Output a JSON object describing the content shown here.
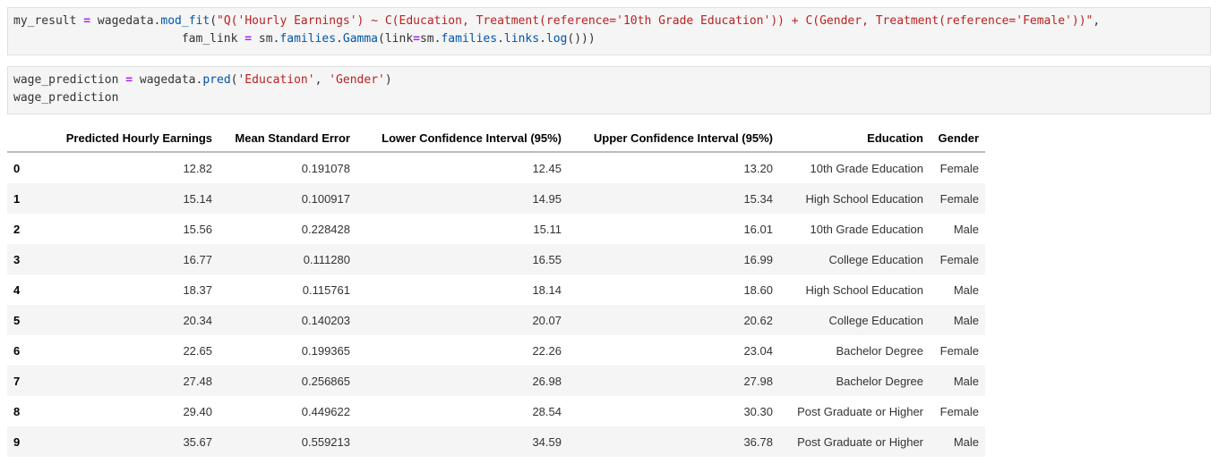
{
  "cells": [
    {
      "lines": [
        [
          {
            "t": "my_result ",
            "c": "tok"
          },
          {
            "t": "=",
            "c": "kw-op"
          },
          {
            "t": " wagedata.",
            "c": "tok"
          },
          {
            "t": "mod_fit",
            "c": "fn"
          },
          {
            "t": "(",
            "c": "tok"
          },
          {
            "t": "\"Q('Hourly Earnings') ~ C(Education, Treatment(reference='10th Grade Education')) + C(Gender, Treatment(reference='Female'))\"",
            "c": "str"
          },
          {
            "t": ",",
            "c": "tok"
          }
        ],
        [
          {
            "t": "                        fam_link ",
            "c": "tok"
          },
          {
            "t": "=",
            "c": "kw-op"
          },
          {
            "t": " sm.",
            "c": "tok"
          },
          {
            "t": "families",
            "c": "fn"
          },
          {
            "t": ".",
            "c": "tok"
          },
          {
            "t": "Gamma",
            "c": "fn"
          },
          {
            "t": "(link",
            "c": "tok"
          },
          {
            "t": "=",
            "c": "kw-op"
          },
          {
            "t": "sm.",
            "c": "tok"
          },
          {
            "t": "families",
            "c": "fn"
          },
          {
            "t": ".",
            "c": "tok"
          },
          {
            "t": "links",
            "c": "fn"
          },
          {
            "t": ".",
            "c": "tok"
          },
          {
            "t": "log",
            "c": "fn"
          },
          {
            "t": "()))",
            "c": "tok"
          }
        ]
      ]
    },
    {
      "lines": [
        [
          {
            "t": "wage_prediction ",
            "c": "tok"
          },
          {
            "t": "=",
            "c": "kw-op"
          },
          {
            "t": " wagedata.",
            "c": "tok"
          },
          {
            "t": "pred",
            "c": "fn"
          },
          {
            "t": "(",
            "c": "tok"
          },
          {
            "t": "'Education'",
            "c": "str"
          },
          {
            "t": ", ",
            "c": "tok"
          },
          {
            "t": "'Gender'",
            "c": "str"
          },
          {
            "t": ")",
            "c": "tok"
          }
        ],
        [
          {
            "t": "wage_prediction",
            "c": "tok"
          }
        ]
      ]
    }
  ],
  "table": {
    "index_header": "",
    "headers": [
      "Predicted Hourly Earnings",
      "Mean Standard Error",
      "Lower Confidence Interval (95%)",
      "Upper Confidence Interval (95%)",
      "Education",
      "Gender"
    ],
    "rows": [
      {
        "index": "0",
        "values": [
          "12.82",
          "0.191078",
          "12.45",
          "13.20",
          "10th Grade Education",
          "Female"
        ]
      },
      {
        "index": "1",
        "values": [
          "15.14",
          "0.100917",
          "14.95",
          "15.34",
          "High School Education",
          "Female"
        ]
      },
      {
        "index": "2",
        "values": [
          "15.56",
          "0.228428",
          "15.11",
          "16.01",
          "10th Grade Education",
          "Male"
        ]
      },
      {
        "index": "3",
        "values": [
          "16.77",
          "0.111280",
          "16.55",
          "16.99",
          "College Education",
          "Female"
        ]
      },
      {
        "index": "4",
        "values": [
          "18.37",
          "0.115761",
          "18.14",
          "18.60",
          "High School Education",
          "Male"
        ]
      },
      {
        "index": "5",
        "values": [
          "20.34",
          "0.140203",
          "20.07",
          "20.62",
          "College Education",
          "Male"
        ]
      },
      {
        "index": "6",
        "values": [
          "22.65",
          "0.199365",
          "22.26",
          "23.04",
          "Bachelor Degree",
          "Female"
        ]
      },
      {
        "index": "7",
        "values": [
          "27.48",
          "0.256865",
          "26.98",
          "27.98",
          "Bachelor Degree",
          "Male"
        ]
      },
      {
        "index": "8",
        "values": [
          "29.40",
          "0.449622",
          "28.54",
          "30.30",
          "Post Graduate or Higher",
          "Female"
        ]
      },
      {
        "index": "9",
        "values": [
          "35.67",
          "0.559213",
          "34.59",
          "36.78",
          "Post Graduate or Higher",
          "Male"
        ]
      }
    ]
  }
}
